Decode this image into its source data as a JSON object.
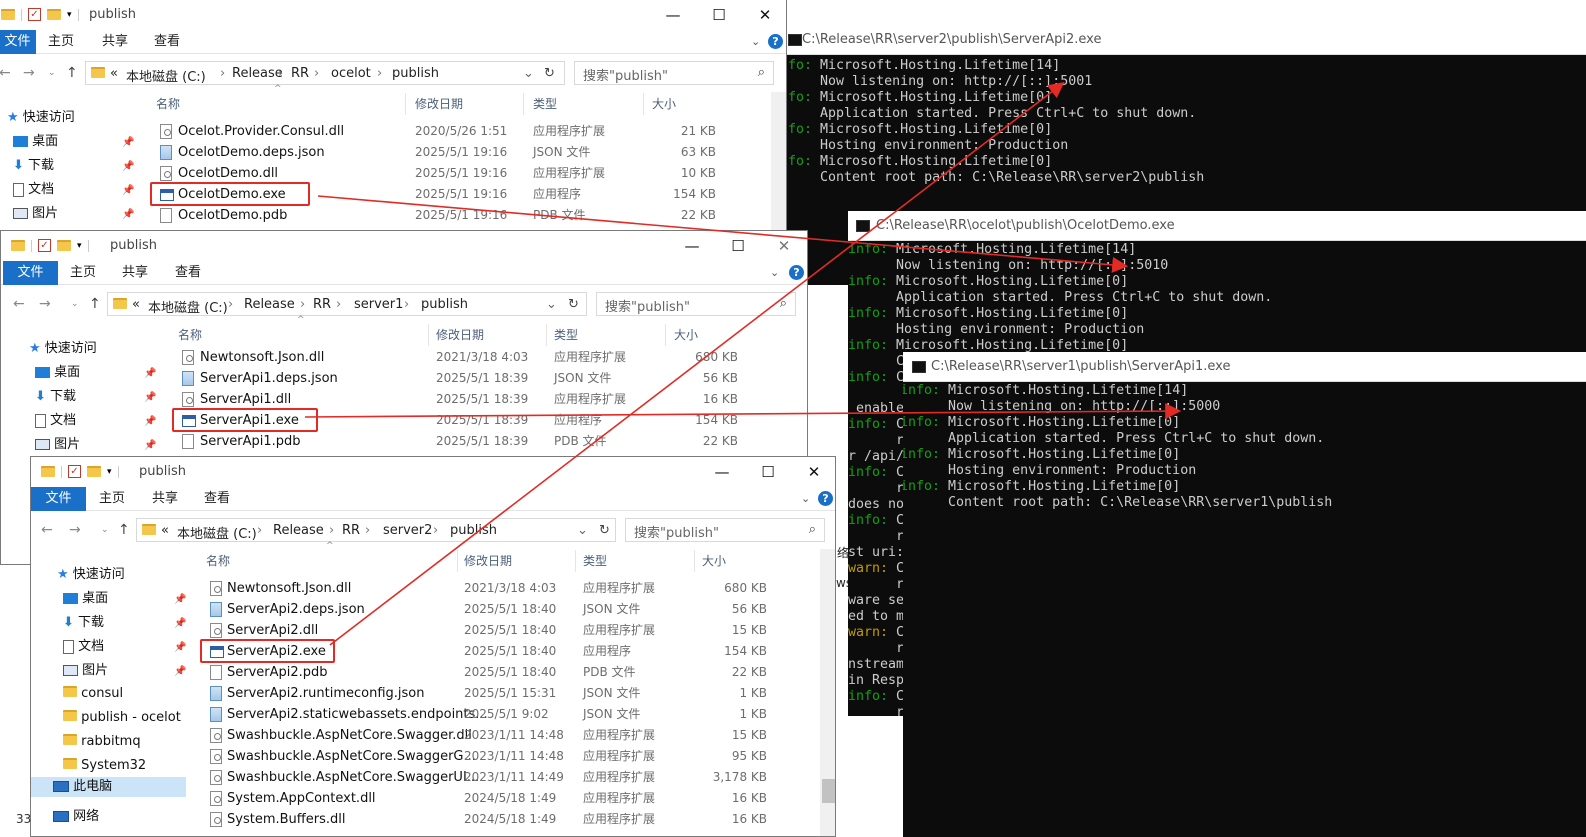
{
  "explorer1": {
    "title": "publish",
    "tabs": [
      "文件",
      "主页",
      "共享",
      "查看"
    ],
    "path": [
      "本地磁盘 (C:)",
      "Release",
      "RR",
      "ocelot",
      "publish"
    ],
    "search_placeholder": "搜索\"publish\"",
    "columns": {
      "name": "名称",
      "date": "修改日期",
      "type": "类型",
      "size": "大小"
    },
    "nav": [
      "快速访问",
      "桌面",
      "下载",
      "文档",
      "图片"
    ],
    "files": [
      {
        "name": "Ocelot.Provider.Consul.dll",
        "date": "2020/5/26 1:51",
        "type": "应用程序扩展",
        "size": "21 KB",
        "icon": "dll"
      },
      {
        "name": "OcelotDemo.deps.json",
        "date": "2025/5/1 19:16",
        "type": "JSON 文件",
        "size": "63 KB",
        "icon": "json"
      },
      {
        "name": "OcelotDemo.dll",
        "date": "2025/5/1 19:16",
        "type": "应用程序扩展",
        "size": "10 KB",
        "icon": "dll"
      },
      {
        "name": "OcelotDemo.exe",
        "date": "2025/5/1 19:16",
        "type": "应用程序",
        "size": "154 KB",
        "icon": "exe"
      },
      {
        "name": "OcelotDemo.pdb",
        "date": "2025/5/1 19:16",
        "type": "PDB 文件",
        "size": "22 KB",
        "icon": "pdb"
      }
    ]
  },
  "explorer2": {
    "title": "publish",
    "tabs": [
      "文件",
      "主页",
      "共享",
      "查看"
    ],
    "path": [
      "本地磁盘 (C:)",
      "Release",
      "RR",
      "server1",
      "publish"
    ],
    "search_placeholder": "搜索\"publish\"",
    "columns": {
      "name": "名称",
      "date": "修改日期",
      "type": "类型",
      "size": "大小"
    },
    "nav": [
      "快速访问",
      "桌面",
      "下载",
      "文档",
      "图片"
    ],
    "files": [
      {
        "name": "Newtonsoft.Json.dll",
        "date": "2021/3/18 4:03",
        "type": "应用程序扩展",
        "size": "680 KB",
        "icon": "dll"
      },
      {
        "name": "ServerApi1.deps.json",
        "date": "2025/5/1 18:39",
        "type": "JSON 文件",
        "size": "56 KB",
        "icon": "json"
      },
      {
        "name": "ServerApi1.dll",
        "date": "2025/5/1 18:39",
        "type": "应用程序扩展",
        "size": "16 KB",
        "icon": "dll"
      },
      {
        "name": "ServerApi1.exe",
        "date": "2025/5/1 18:39",
        "type": "应用程序",
        "size": "154 KB",
        "icon": "exe"
      },
      {
        "name": "ServerApi1.pdb",
        "date": "2025/5/1 18:39",
        "type": "PDB 文件",
        "size": "22 KB",
        "icon": "pdb"
      }
    ]
  },
  "explorer3": {
    "title": "publish",
    "tabs": [
      "文件",
      "主页",
      "共享",
      "查看"
    ],
    "path": [
      "本地磁盘 (C:)",
      "Release",
      "RR",
      "server2",
      "publish"
    ],
    "search_placeholder": "搜索\"publish\"",
    "columns": {
      "name": "名称",
      "date": "修改日期",
      "type": "类型",
      "size": "大小"
    },
    "nav": [
      "快速访问",
      "桌面",
      "下载",
      "文档",
      "图片",
      "consul",
      "publish - ocelot",
      "rabbitmq",
      "System32",
      "此电脑",
      "网络"
    ],
    "status_count": "33",
    "files": [
      {
        "name": "Newtonsoft.Json.dll",
        "date": "2021/3/18 4:03",
        "type": "应用程序扩展",
        "size": "680 KB",
        "icon": "dll"
      },
      {
        "name": "ServerApi2.deps.json",
        "date": "2025/5/1 18:40",
        "type": "JSON 文件",
        "size": "56 KB",
        "icon": "json"
      },
      {
        "name": "ServerApi2.dll",
        "date": "2025/5/1 18:40",
        "type": "应用程序扩展",
        "size": "15 KB",
        "icon": "dll"
      },
      {
        "name": "ServerApi2.exe",
        "date": "2025/5/1 18:40",
        "type": "应用程序",
        "size": "154 KB",
        "icon": "exe"
      },
      {
        "name": "ServerApi2.pdb",
        "date": "2025/5/1 18:40",
        "type": "PDB 文件",
        "size": "22 KB",
        "icon": "pdb"
      },
      {
        "name": "ServerApi2.runtimeconfig.json",
        "date": "2025/5/1 15:31",
        "type": "JSON 文件",
        "size": "1 KB",
        "icon": "json"
      },
      {
        "name": "ServerApi2.staticwebassets.endpoints...",
        "date": "2025/5/1 9:02",
        "type": "JSON 文件",
        "size": "1 KB",
        "icon": "json"
      },
      {
        "name": "Swashbuckle.AspNetCore.Swagger.dll",
        "date": "2023/1/11 14:48",
        "type": "应用程序扩展",
        "size": "15 KB",
        "icon": "dll"
      },
      {
        "name": "Swashbuckle.AspNetCore.SwaggerG...",
        "date": "2023/1/11 14:48",
        "type": "应用程序扩展",
        "size": "95 KB",
        "icon": "dll"
      },
      {
        "name": "Swashbuckle.AspNetCore.SwaggerUI...",
        "date": "2023/1/11 14:49",
        "type": "应用程序扩展",
        "size": "3,178 KB",
        "icon": "dll"
      },
      {
        "name": "System.AppContext.dll",
        "date": "2024/5/18 1:49",
        "type": "应用程序扩展",
        "size": "16 KB",
        "icon": "dll"
      },
      {
        "name": "System.Buffers.dll",
        "date": "2024/5/18 1:49",
        "type": "应用程序扩展",
        "size": "16 KB",
        "icon": "dll"
      }
    ]
  },
  "console_server2": {
    "title": "C:\\Release\\RR\\server2\\publish\\ServerApi2.exe",
    "lines": [
      {
        "p": "info:",
        "t": " Microsoft.Hosting.Lifetime[14]"
      },
      {
        "p": "",
        "t": "      Now listening on: http://[::]:5001"
      },
      {
        "p": "info:",
        "t": " Microsoft.Hosting.Lifetime[0]"
      },
      {
        "p": "",
        "t": "      Application started. Press Ctrl+C to shut down."
      },
      {
        "p": "info:",
        "t": " Microsoft.Hosting.Lifetime[0]"
      },
      {
        "p": "",
        "t": "      Hosting environment: Production"
      },
      {
        "p": "info:",
        "t": " Microsoft.Hosting.Lifetime[0]"
      },
      {
        "p": "",
        "t": "      Content root path: C:\\Release\\RR\\server2\\publish"
      }
    ]
  },
  "console_ocelot": {
    "title": "C:\\Release\\RR\\ocelot\\publish\\OcelotDemo.exe",
    "lines": [
      {
        "p": "info:",
        "t": " Microsoft.Hosting.Lifetime[14]"
      },
      {
        "p": "",
        "t": "      Now listening on: http://[::]:5010"
      },
      {
        "p": "info:",
        "t": " Microsoft.Hosting.Lifetime[0]"
      },
      {
        "p": "",
        "t": "      Application started. Press Ctrl+C to shut down."
      },
      {
        "p": "info:",
        "t": " Microsoft.Hosting.Lifetime[0]"
      },
      {
        "p": "",
        "t": "      Hosting environment: Production"
      },
      {
        "p": "info:",
        "t": " Microsoft.Hosting.Lifetime[0]"
      }
    ],
    "left_fragments": [
      {
        "p": "",
        "t": "      C"
      },
      {
        "p": "info:",
        "t": " C"
      },
      {
        "p": "",
        "t": " enable"
      },
      {
        "p": "info:",
        "t": " C"
      },
      {
        "p": "",
        "t": "      r"
      },
      {
        "p": "",
        "t": "r /api/"
      },
      {
        "p": "info:",
        "t": " C"
      },
      {
        "p": "",
        "t": "      r"
      },
      {
        "p": "",
        "t": "does no"
      },
      {
        "p": "info:",
        "t": " C"
      },
      {
        "p": "",
        "t": "      r"
      },
      {
        "p": "",
        "t": "st uri:"
      },
      {
        "p": "warn:",
        "t": " C"
      },
      {
        "p": "",
        "t": "      r"
      },
      {
        "p": "",
        "t": "ware se"
      },
      {
        "p": "",
        "t": "ed to m"
      },
      {
        "p": "warn:",
        "t": " C"
      },
      {
        "p": "",
        "t": "      r"
      },
      {
        "p": "",
        "t": "nstream"
      },
      {
        "p": "",
        "t": "in Resp"
      },
      {
        "p": "info:",
        "t": " C"
      },
      {
        "p": "",
        "t": "      r"
      }
    ]
  },
  "console_server1": {
    "title": "C:\\Release\\RR\\server1\\publish\\ServerApi1.exe",
    "lines": [
      {
        "p": "info:",
        "t": " Microsoft.Hosting.Lifetime[14]"
      },
      {
        "p": "",
        "t": "      Now listening on: http://[::]:5000"
      },
      {
        "p": "info:",
        "t": " Microsoft.Hosting.Lifetime[0]"
      },
      {
        "p": "",
        "t": "      Application started. Press Ctrl+C to shut down."
      },
      {
        "p": "info:",
        "t": " Microsoft.Hosting.Lifetime[0]"
      },
      {
        "p": "",
        "t": "      Hosting environment: Production"
      },
      {
        "p": "info:",
        "t": " Microsoft.Hosting.Lifetime[0]"
      },
      {
        "p": "",
        "t": "      Content root path: C:\\Release\\RR\\server1\\publish"
      }
    ]
  },
  "background_window_text": [
    "络",
    "ws"
  ],
  "colors": {
    "accent": "#1a70c8",
    "highlight": "#e32b25",
    "console_bg": "#0c0c0c",
    "console_text": "#cccccc",
    "info_green": "#13a10e",
    "warn_yellow": "#c19c00"
  }
}
